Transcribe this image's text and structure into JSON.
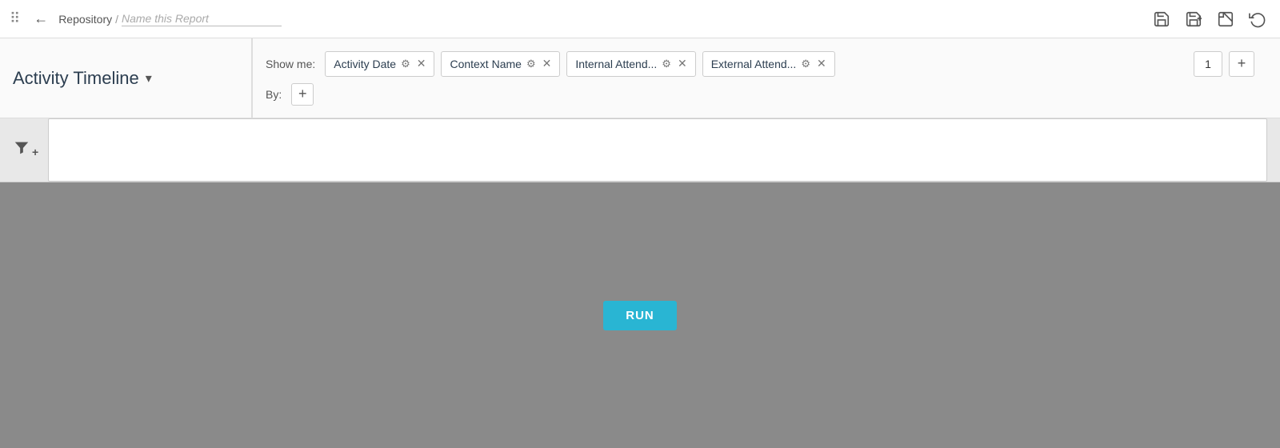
{
  "topbar": {
    "back_label": "←",
    "breadcrumb_repo": "Repository",
    "breadcrumb_sep": "/",
    "breadcrumb_name": "Name this Report",
    "save_icon": "💾",
    "save_as_icon": "🖫",
    "chart_icon": "📊",
    "undo_icon": "↺",
    "dots_icon": "⋮⋮"
  },
  "config": {
    "report_title": "Activity Timeline",
    "dropdown_arrow": "▾",
    "show_me_label": "Show me:",
    "by_label": "By:",
    "fields": [
      {
        "id": "activity-date",
        "label": "Activity Date"
      },
      {
        "id": "context-name",
        "label": "Context Name"
      },
      {
        "id": "internal-attend",
        "label": "Internal Attend..."
      },
      {
        "id": "external-attend",
        "label": "External Attend..."
      }
    ],
    "page_number": "1",
    "add_page_label": "+",
    "add_field_label": "+"
  },
  "filter": {
    "filter_icon": "▼",
    "filter_plus": "+"
  },
  "main": {
    "run_label": "RUN"
  }
}
